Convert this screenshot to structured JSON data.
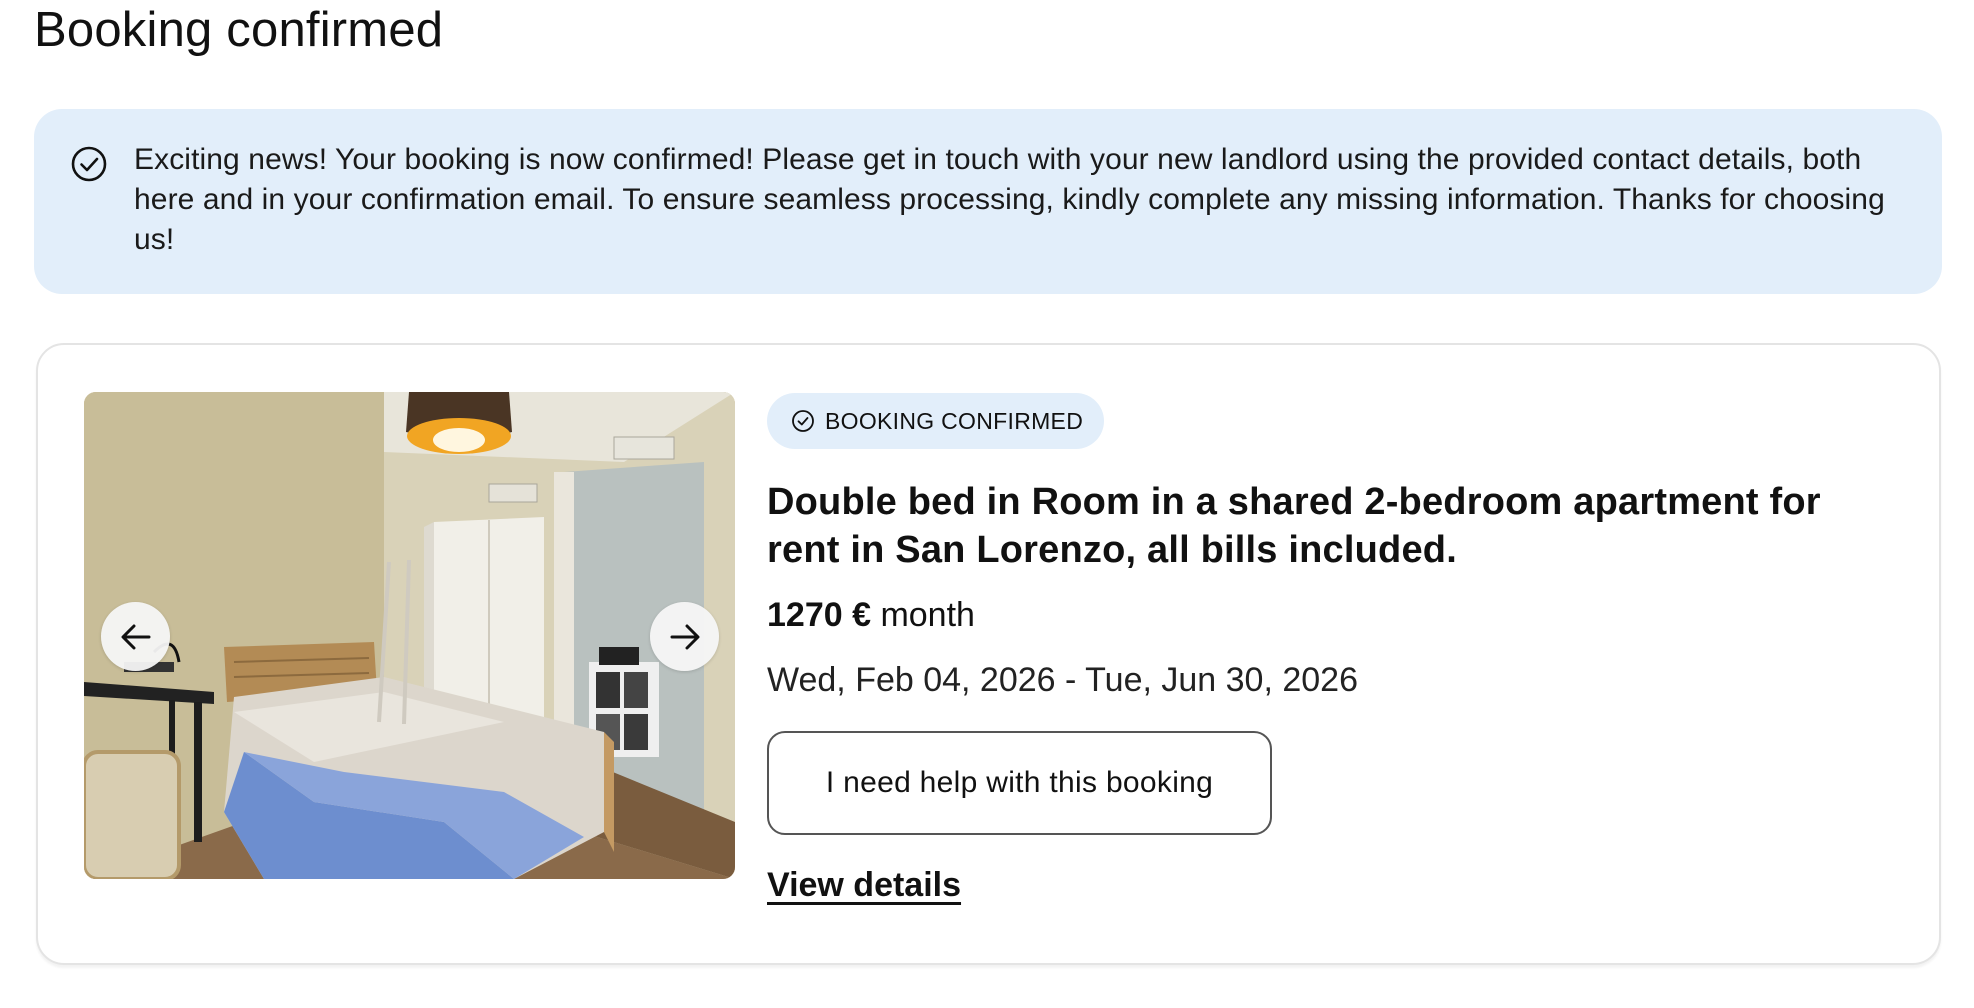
{
  "page": {
    "title": "Booking confirmed"
  },
  "alert": {
    "icon": "check-circle-icon",
    "message": "Exciting news! Your booking is now confirmed! Please get in touch with your new landlord using the provided contact details, both here and in your confirmation email. To ensure seamless processing, kindly complete any missing information. Thanks for choosing us!",
    "background_color": "#e2eefa"
  },
  "booking": {
    "status_badge": {
      "icon": "check-circle-icon",
      "label": "BOOKING CONFIRMED"
    },
    "title": "Double bed in Room in a shared 2-bedroom apartment for rent in San Lorenzo, all bills included.",
    "price": {
      "amount": "1270 €",
      "period": "month"
    },
    "dates": "Wed, Feb 04, 2026 - Tue, Jun 30, 2026",
    "help_button_label": "I need help with this booking",
    "view_details_label": "View details",
    "carousel": {
      "prev_icon": "arrow-left-icon",
      "next_icon": "arrow-right-icon"
    }
  }
}
